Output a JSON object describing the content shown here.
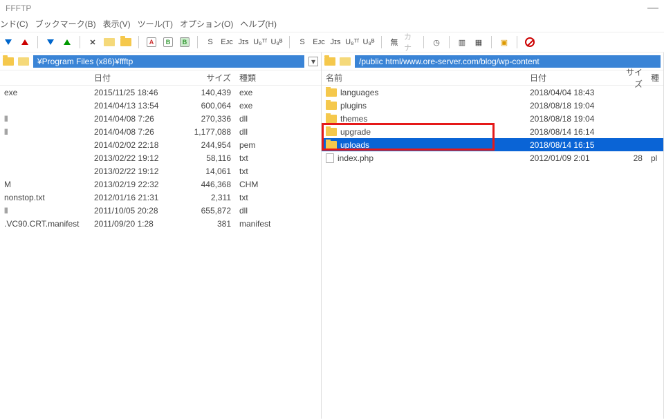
{
  "window": {
    "title": "FFFTP"
  },
  "menu": {
    "items": [
      "ンド(C)",
      "ブックマーク(B)",
      "表示(V)",
      "ツール(T)",
      "オプション(O)",
      "ヘルプ(H)"
    ]
  },
  "toolbar": {
    "groups": [
      [
        "B",
        "B"
      ],
      [
        "S",
        "Eᴊc",
        "Jɪs",
        "U₈ᵀᶠ",
        "U₈ᴮ"
      ],
      [
        "S",
        "Eᴊc",
        "Jɪs",
        "U₈ᵀᶠ",
        "U₈ᴮ"
      ],
      [
        "無",
        "カナ"
      ]
    ]
  },
  "left": {
    "path": "¥Program Files (x86)¥ffftp",
    "headers": {
      "date": "日付",
      "size": "サイズ",
      "kind": "種類"
    },
    "files": [
      {
        "name": "exe",
        "date": "2015/11/25 18:46",
        "size": "140,439",
        "kind": "exe"
      },
      {
        "name": "",
        "date": "2014/04/13 13:54",
        "size": "600,064",
        "kind": "exe"
      },
      {
        "name": "ll",
        "date": "2014/04/08 7:26",
        "size": "270,336",
        "kind": "dll"
      },
      {
        "name": "ll",
        "date": "2014/04/08 7:26",
        "size": "1,177,088",
        "kind": "dll"
      },
      {
        "name": "",
        "date": "2014/02/02 22:18",
        "size": "244,954",
        "kind": "pem"
      },
      {
        "name": "",
        "date": "2013/02/22 19:12",
        "size": "58,116",
        "kind": "txt"
      },
      {
        "name": "",
        "date": "2013/02/22 19:12",
        "size": "14,061",
        "kind": "txt"
      },
      {
        "name": "M",
        "date": "2013/02/19 22:32",
        "size": "446,368",
        "kind": "CHM"
      },
      {
        "name": "nonstop.txt",
        "date": "2012/01/16 21:31",
        "size": "2,311",
        "kind": "txt"
      },
      {
        "name": "ll",
        "date": "2011/10/05 20:28",
        "size": "655,872",
        "kind": "dll"
      },
      {
        "name": ".VC90.CRT.manifest",
        "date": "2011/09/20 1:28",
        "size": "381",
        "kind": "manifest"
      }
    ]
  },
  "right": {
    "path": "/public html/www.ore-server.com/blog/wp-content",
    "headers": {
      "name": "名前",
      "date": "日付",
      "size": "サイズ",
      "kind": "種"
    },
    "files": [
      {
        "name": "languages",
        "date": "2018/04/04 18:43",
        "size": "<DIR>",
        "type": "folder"
      },
      {
        "name": "plugins",
        "date": "2018/08/18 19:04",
        "size": "<DIR>",
        "type": "folder"
      },
      {
        "name": "themes",
        "date": "2018/08/18 19:04",
        "size": "<DIR>",
        "type": "folder"
      },
      {
        "name": "upgrade",
        "date": "2018/08/14 16:14",
        "size": "<DIR>",
        "type": "folder"
      },
      {
        "name": "uploads",
        "date": "2018/08/14 16:15",
        "size": "<DIR>",
        "type": "folder",
        "selected": true
      },
      {
        "name": "index.php",
        "date": "2012/01/09 2:01",
        "size": "28",
        "kind": "pl",
        "type": "file"
      }
    ]
  }
}
